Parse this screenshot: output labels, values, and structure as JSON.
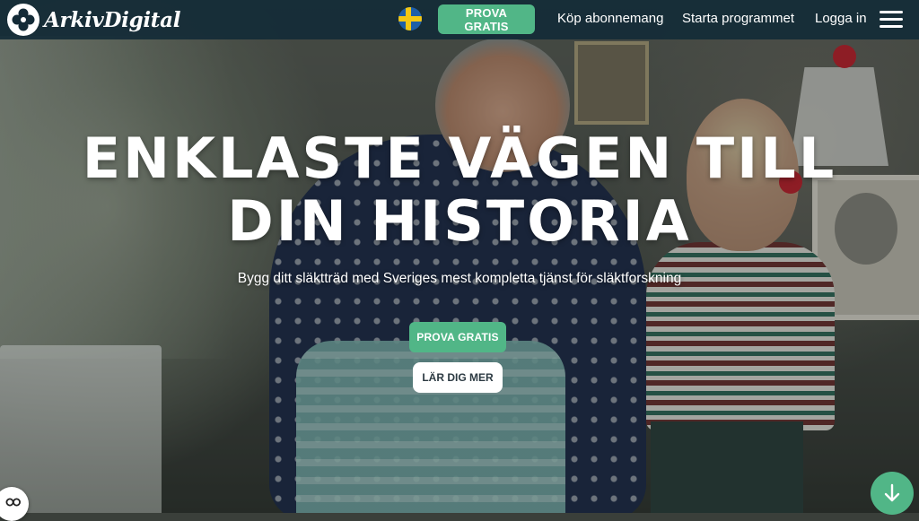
{
  "header": {
    "logo_text": "ArkivDigital",
    "language_flag": "sweden-flag-icon",
    "try_free_label": "PROVA GRATIS",
    "nav": {
      "subscribe": "Köp abonnemang",
      "start_program": "Starta programmet",
      "login": "Logga in"
    },
    "menu_icon": "hamburger-menu-icon"
  },
  "hero": {
    "headline_line1": "ENKLASTE VÄGEN TILL",
    "headline_line2": "DIN HISTORIA",
    "subheadline": "Bygg ditt släktträd med Sveriges mest kompletta tjänst för släktforskning",
    "try_free_label": "PROVA GRATIS",
    "learn_more_label": "LÄR DIG MER",
    "scroll_icon": "arrow-down-icon",
    "cookie_icon": "cookie-settings-icon"
  },
  "colors": {
    "header_bg": "#142b37",
    "accent_green": "#51b687",
    "white": "#ffffff"
  }
}
